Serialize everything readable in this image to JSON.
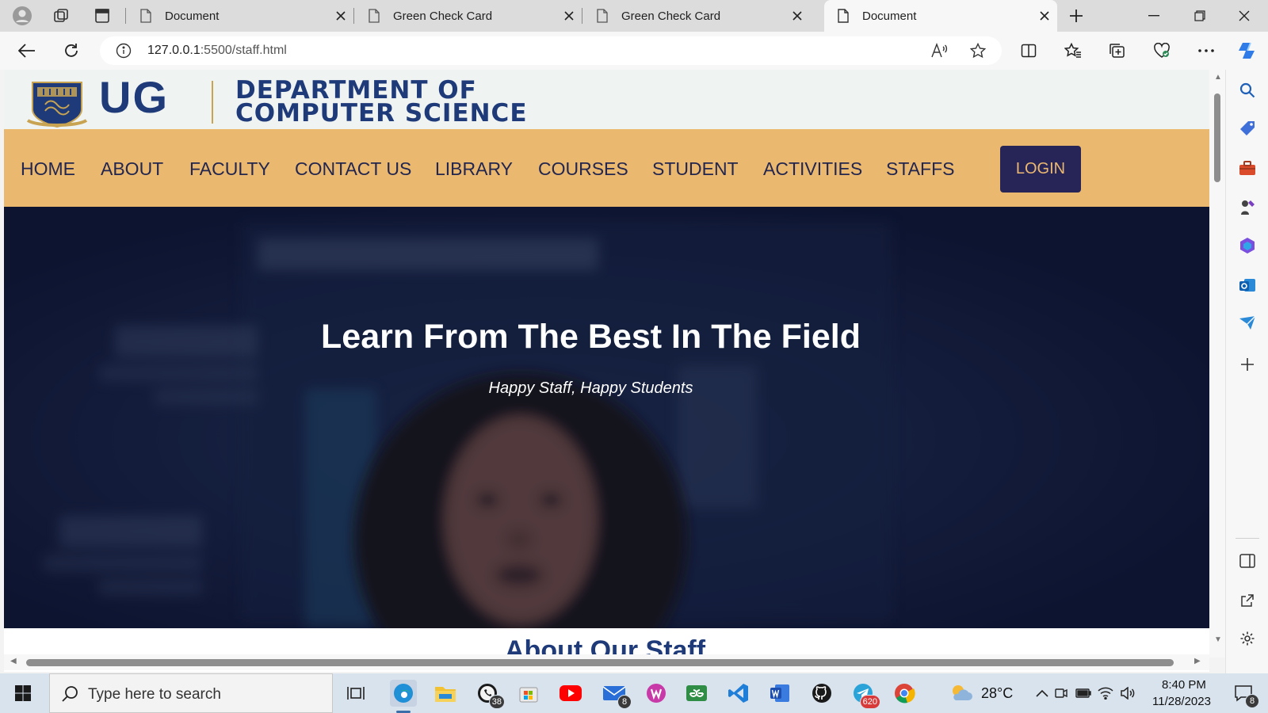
{
  "browser": {
    "tabs": [
      {
        "title": "Document",
        "active": false
      },
      {
        "title": "Green Check Card",
        "active": false
      },
      {
        "title": "Green Check Card",
        "active": false
      },
      {
        "title": "Document",
        "active": true
      }
    ],
    "address": {
      "host": "127.0.0.1",
      "path": ":5500/staff.html"
    }
  },
  "site": {
    "logo_text": "UG",
    "dept_line1": "DEPARTMENT OF",
    "dept_line2": "COMPUTER SCIENCE",
    "nav": [
      "HOME",
      "ABOUT",
      "FACULTY",
      "CONTACT US",
      "LIBRARY",
      "COURSES",
      "STUDENT",
      "ACTIVITIES",
      "STAFFS"
    ],
    "login_label": "LOGIN",
    "hero_title": "Learn From The Best In The Field",
    "hero_subtitle": "Happy Staff, Happy Students",
    "next_section_heading": "About Our Staff",
    "colors": {
      "header_bg": "#eff3f2",
      "nav_bg": "#ebb870",
      "nav_text": "#23264e",
      "login_bg": "#272558",
      "brand_blue": "#1e3a78",
      "hero_bg": "#131c38"
    }
  },
  "taskbar": {
    "search_placeholder": "Type here to search",
    "whatsapp_badge": "38",
    "mail_badge": "8",
    "telegram_badge": "620",
    "weather": "28°C",
    "time": "8:40 PM",
    "date": "11/28/2023",
    "notification_count": "8"
  }
}
